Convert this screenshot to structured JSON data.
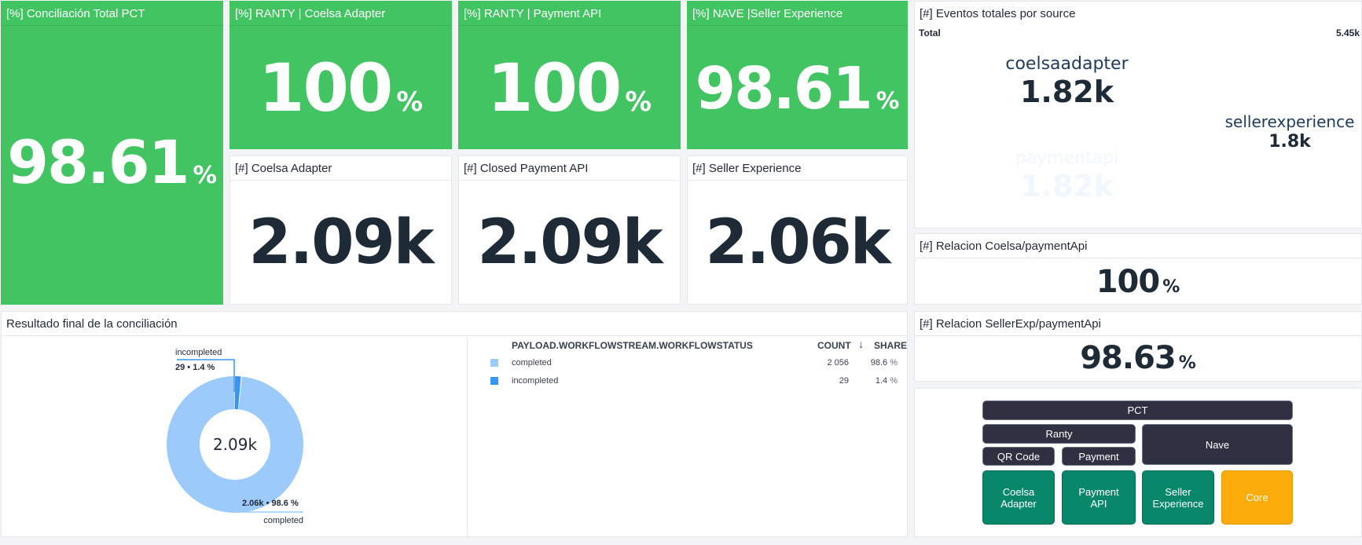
{
  "tiles": {
    "conciliacion_total": {
      "title": "[%] Conciliación Total PCT",
      "value": "98.61",
      "unit": "%"
    },
    "ranty_coelsa": {
      "title": "[%] RANTY | Coelsa Adapter",
      "value": "100",
      "unit": "%"
    },
    "ranty_payment": {
      "title": "[%] RANTY | Payment API",
      "value": "100",
      "unit": "%"
    },
    "nave_seller": {
      "title": "[%] NAVE |Seller Experience",
      "value": "98.61",
      "unit": "%"
    },
    "coelsa_count": {
      "title": "[#] Coelsa Adapter",
      "value": "2.09k"
    },
    "payment_count": {
      "title": "[#] Closed Payment API",
      "value": "2.09k"
    },
    "seller_count": {
      "title": "[#] Seller Experience",
      "value": "2.06k"
    },
    "relacion_coelsa": {
      "title": "[#] Relacion Coelsa/paymentApi",
      "value": "100",
      "unit": "%"
    },
    "relacion_seller": {
      "title": "[#] Relacion SellerExp/paymentApi",
      "value": "98.63",
      "unit": "%"
    }
  },
  "treemap": {
    "title": "[#] Eventos totales por source",
    "total_label": "Total",
    "total_value": "5.45k",
    "cells": [
      {
        "name": "coelsaadapter",
        "value": "1.82k",
        "color": "#9ccbfb"
      },
      {
        "name": "paymentapi",
        "value": "1.82k",
        "color": "#3797ee"
      },
      {
        "name": "sellerexperience",
        "value": "1.8k",
        "color": "#d6c4fb"
      }
    ]
  },
  "donut": {
    "title": "Resultado final de la conciliación",
    "center_label": "2.09k",
    "incompleted_label": "incompleted",
    "incompleted_detail": "29 • 1.4 %",
    "completed_label": "completed",
    "completed_detail": "2.06k • 98.6 %"
  },
  "table": {
    "col_status": "PAYLOAD.WORKFLOWSTREAM.WORKFLOWSTATUS",
    "col_count": "COUNT",
    "col_share": "SHARE",
    "sort_icon": "arrow-down-icon",
    "rows": [
      {
        "status": "completed",
        "count": "2 056",
        "share": "98.6",
        "share_unit": "%",
        "color": "#9ccbfb"
      },
      {
        "status": "incompleted",
        "count": "29",
        "share": "1.4",
        "share_unit": "%",
        "color": "#3797ee"
      }
    ]
  },
  "diagram": {
    "pct": "PCT",
    "ranty": "Ranty",
    "nave": "Nave",
    "qr_code": "QR Code",
    "payment": "Payment",
    "coelsa_adapter_l1": "Coelsa",
    "coelsa_adapter_l2": "Adapter",
    "payment_api_l1": "Payment",
    "payment_api_l2": "API",
    "seller_exp_l1": "Seller",
    "seller_exp_l2": "Experience",
    "core": "Core"
  },
  "chart_data": {
    "type": "pie",
    "categories": [
      "completed",
      "incompleted"
    ],
    "values": [
      2056,
      29
    ],
    "shares": [
      98.6,
      1.4
    ],
    "colors": [
      "#9ccbfb",
      "#3797ee"
    ],
    "center_label": "2.09k"
  }
}
